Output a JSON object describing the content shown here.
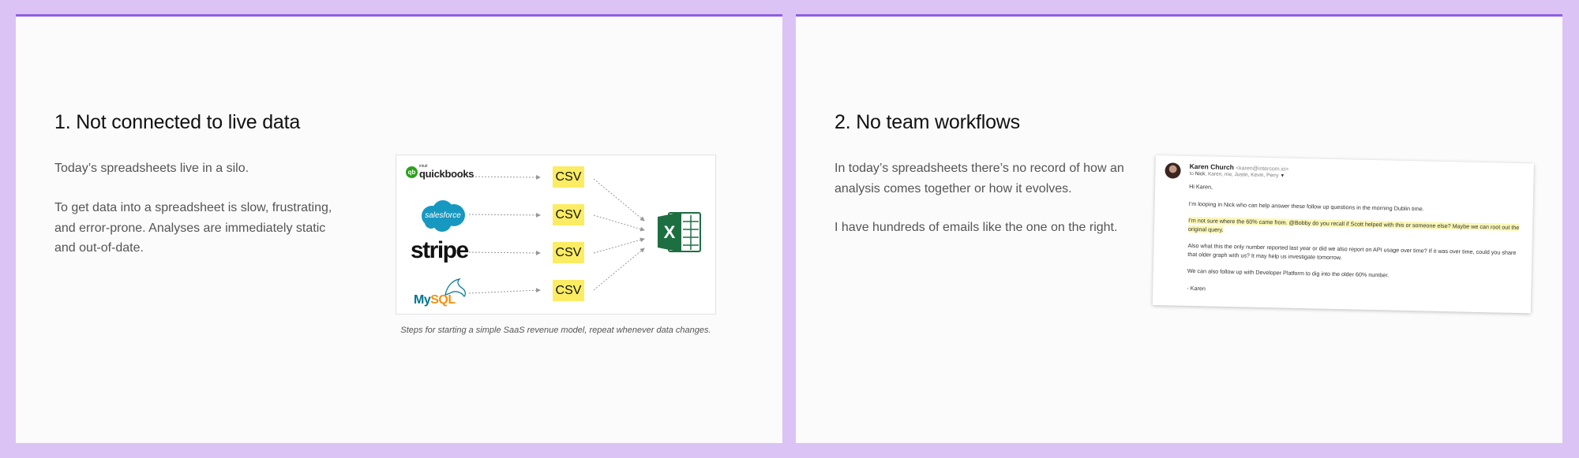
{
  "slide1": {
    "title": "1. Not connected to live data",
    "paragraph1": "Today’s spreadsheets live in a silo.",
    "paragraph2": "To get data into a spreadsheet is slow, frustrating, and error-prone. Analyses are immediately static and out-of-date.",
    "diagram": {
      "sources": [
        {
          "name": "quickbooks",
          "intuit": "intuit",
          "label": "quickbooks",
          "icon": "quickbooks-logo"
        },
        {
          "name": "salesforce",
          "label": "salesforce",
          "icon": "salesforce-logo"
        },
        {
          "name": "stripe",
          "label": "stripe",
          "icon": "stripe-logo"
        },
        {
          "name": "mysql",
          "label_a": "My",
          "label_b": "SQL",
          "icon": "mysql-logo"
        }
      ],
      "csv_label": "CSV",
      "target_icon": "excel-icon",
      "caption": "Steps for starting a simple SaaS revenue model, repeat whenever data changes."
    }
  },
  "slide2": {
    "title": "2. No team workflows",
    "paragraph1": "In today’s spreadsheets there’s no record of how an analysis comes together or how it evolves.",
    "paragraph2": "I have hundreds of emails like the one on the right.",
    "email": {
      "sender_name": "Karen Church",
      "sender_address": "<karen@intercom.io>",
      "to_prefix": "to",
      "to_first": "Nick",
      "to_rest": ", Karen, me, Justin, Kevin, Perry",
      "greeting": "Hi Karen,",
      "line1": "I’m looping in Nick who can help answer these follow up questions in the morning Dublin time.",
      "highlighted": "I’m not sure where the 60% came from. @Bobby do you recall if Scott helped with this or someone else? Maybe we can root out the original query.",
      "line2": "Also what this the only number reported last year or did we also report on API usage over time? If it was over time, could you share that older graph with us? It may help us investigate tomorrow.",
      "line3": "We can also follow up with Developer Platform to dig into the older 60% number.",
      "signoff": "- Karen"
    }
  },
  "colors": {
    "background": "#dcc3f5",
    "accent_border": "#8f5ee0",
    "csv_fill": "#fbec63",
    "excel_green": "#1d6f42",
    "highlight": "#fbf7b6"
  }
}
